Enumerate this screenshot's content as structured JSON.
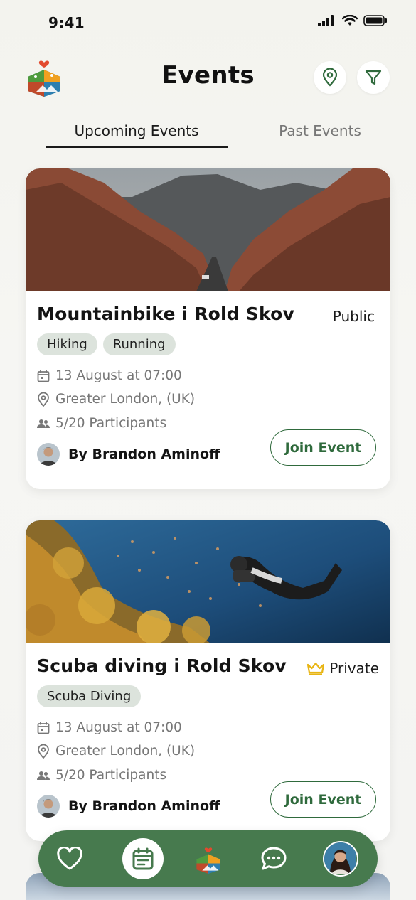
{
  "status_bar": {
    "time": "9:41"
  },
  "header": {
    "title": "Events"
  },
  "tabs": [
    {
      "label": "Upcoming Events",
      "active": true
    },
    {
      "label": "Past Events",
      "active": false
    }
  ],
  "events": [
    {
      "title": "Mountainbike i Rold Skov",
      "visibility": "Public",
      "tags": [
        "Hiking",
        "Running"
      ],
      "date": "13 August at 07:00",
      "location": "Greater London, (UK)",
      "participants": "5/20 Participants",
      "organizer": "By Brandon Aminoff",
      "join_label": "Join Event"
    },
    {
      "title": "Scuba diving i Rold Skov",
      "visibility": "Private",
      "tags": [
        "Scuba Diving"
      ],
      "date": "13 August at 07:00",
      "location": "Greater London, (UK)",
      "participants": "5/20 Participants",
      "organizer": "By Brandon Aminoff",
      "join_label": "Join Event"
    }
  ],
  "colors": {
    "brand_green": "#477a4e",
    "button_green": "#2f6a3c",
    "tag_bg": "#dce3dc",
    "crown": "#e8b514"
  },
  "icons": [
    "location-pin-icon",
    "filter-icon",
    "calendar-icon",
    "people-icon",
    "crown-icon",
    "heart-icon",
    "chat-icon"
  ]
}
